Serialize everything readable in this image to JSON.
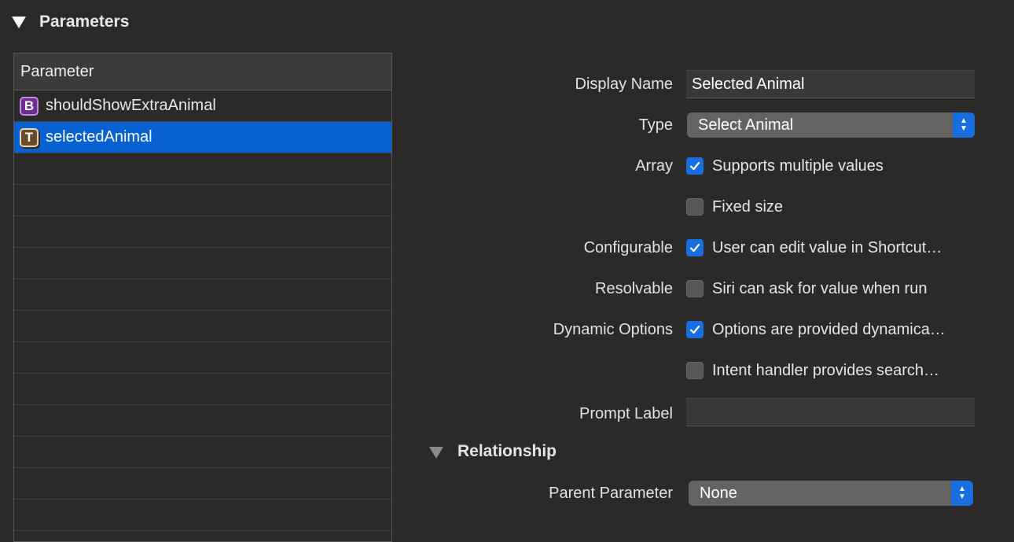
{
  "section": {
    "title": "Parameters"
  },
  "table": {
    "header": "Parameter",
    "rows": [
      {
        "badge": "B",
        "name": "shouldShowExtraAnimal",
        "selected": false
      },
      {
        "badge": "T",
        "name": "selectedAnimal",
        "selected": true
      }
    ]
  },
  "form": {
    "display_name_label": "Display Name",
    "display_name_value": "Selected Animal",
    "type_label": "Type",
    "type_value": "Select Animal",
    "array_label": "Array",
    "supports_multiple": {
      "text": "Supports multiple values",
      "checked": true
    },
    "fixed_size": {
      "text": "Fixed size",
      "checked": false
    },
    "configurable_label": "Configurable",
    "user_can_edit": {
      "text": "User can edit value in Shortcut…",
      "checked": true
    },
    "resolvable_label": "Resolvable",
    "siri_can_ask": {
      "text": "Siri can ask for value when run",
      "checked": false
    },
    "dynamic_options_label": "Dynamic Options",
    "options_dynamic": {
      "text": "Options are provided dynamica…",
      "checked": true
    },
    "intent_handler": {
      "text": "Intent handler provides search…",
      "checked": false
    },
    "prompt_label_label": "Prompt Label",
    "prompt_label_value": ""
  },
  "relationship": {
    "title": "Relationship",
    "parent_label": "Parent Parameter",
    "parent_value": "None"
  },
  "colors": {
    "accent": "#1a6fe0",
    "selection": "#0761d1",
    "background": "#2b2a29"
  }
}
